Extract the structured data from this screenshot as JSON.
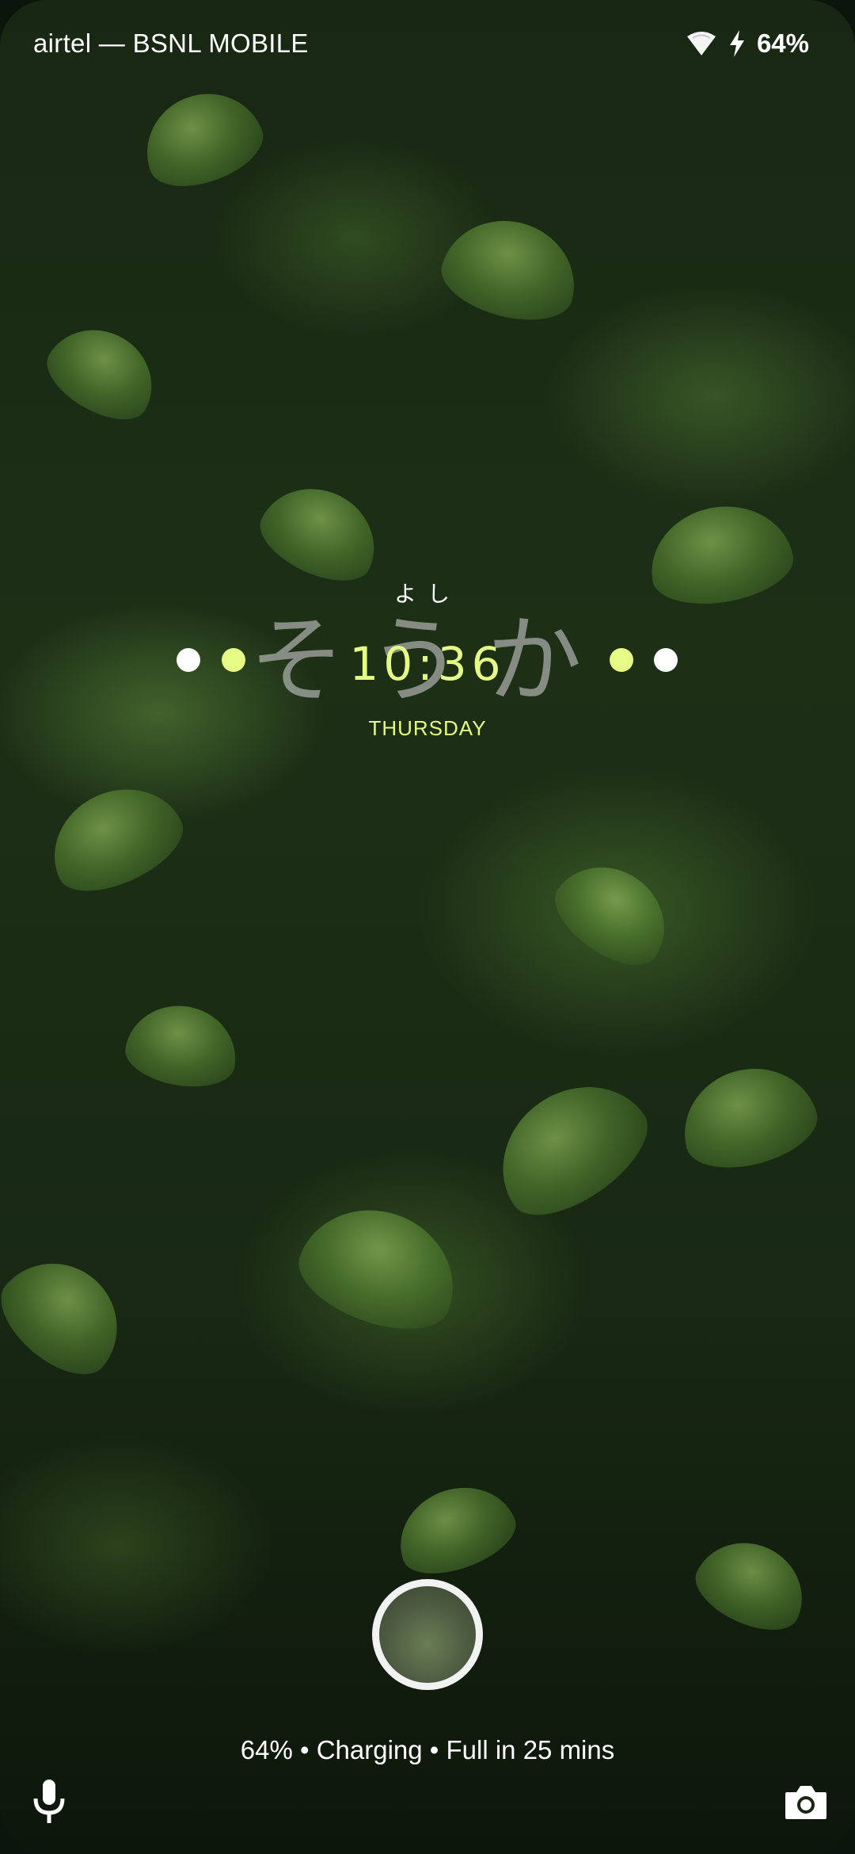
{
  "status_bar": {
    "carrier": "airtel — BSNL MOBILE",
    "battery_percent": "64%",
    "icons": [
      "wifi-icon",
      "charging-bolt-icon"
    ]
  },
  "clock": {
    "subtitle": "よし",
    "kana": "そうか",
    "time": "10:36",
    "day": "THURSDAY",
    "accent_color": "#e6fb86"
  },
  "lockscreen": {
    "charging_status": "64% • Charging • Full in 25 mins",
    "fingerprint_icon": "fingerprint-sensor-icon",
    "left_shortcut_icon": "microphone-icon",
    "right_shortcut_icon": "camera-icon"
  }
}
